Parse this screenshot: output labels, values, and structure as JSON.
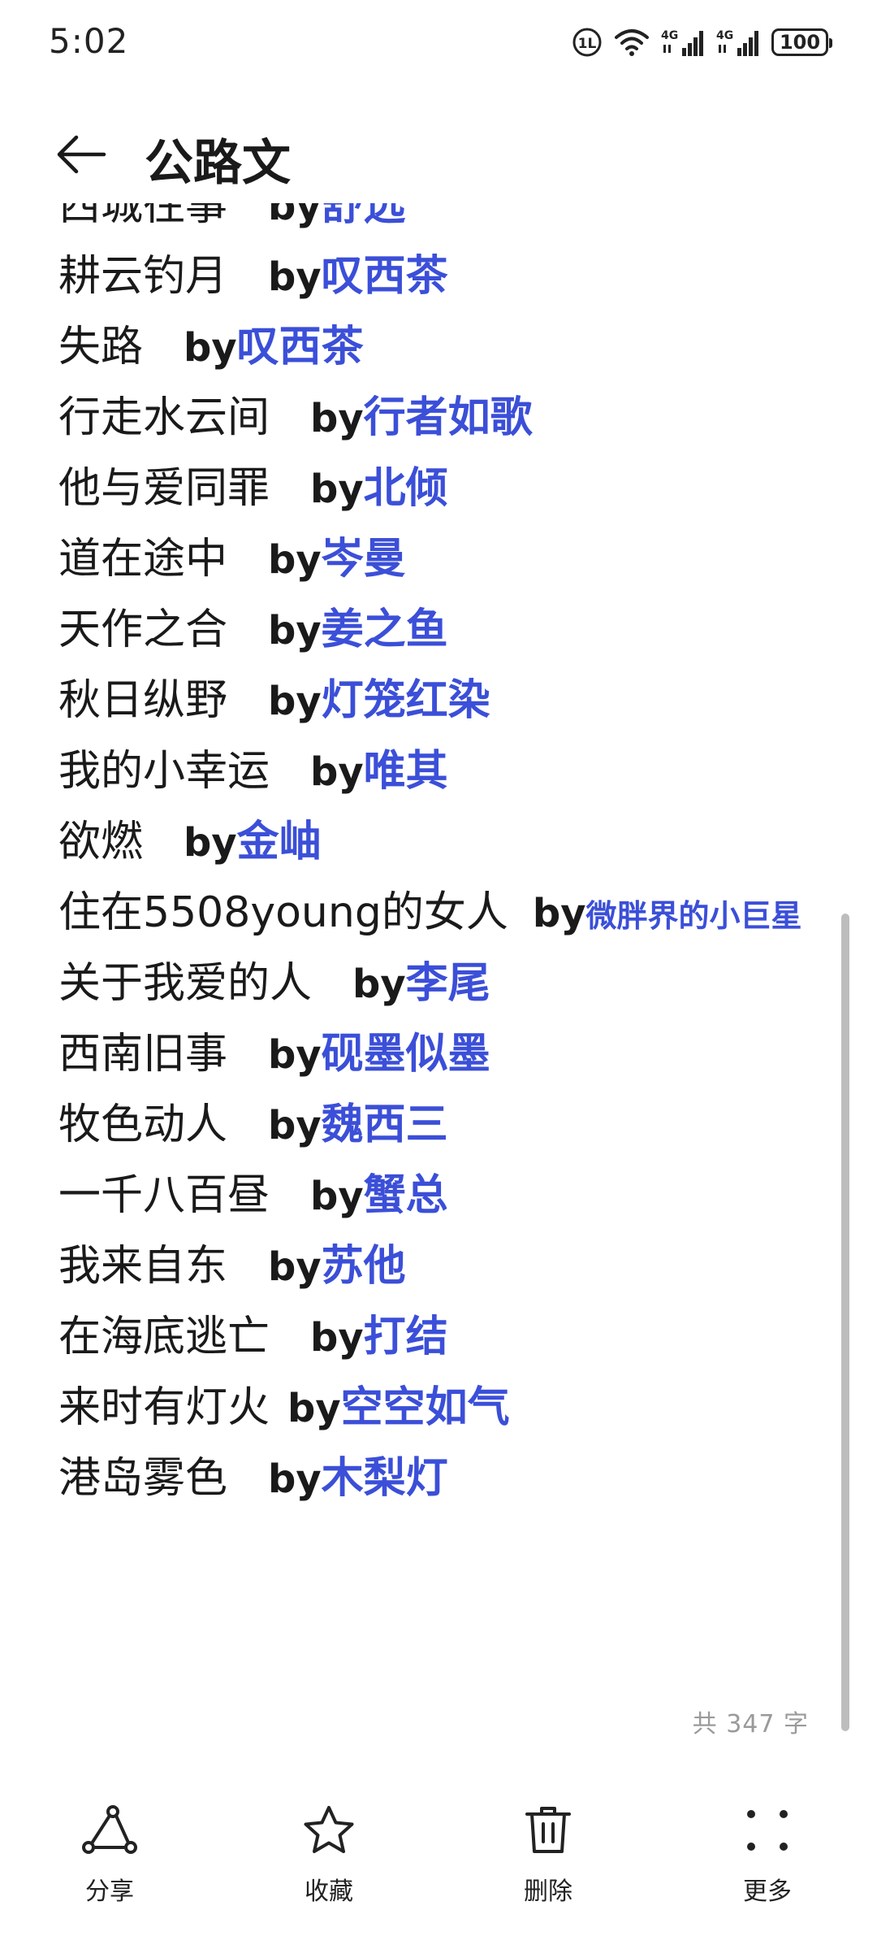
{
  "status_bar": {
    "time": "5:02",
    "battery": "100",
    "network_1": "4G",
    "network_2": "4G"
  },
  "header": {
    "title": "公路文"
  },
  "entries": [
    {
      "title": "西城往事",
      "by": "by",
      "author": "舒远"
    },
    {
      "title": "耕云钓月",
      "by": "by",
      "author": "叹西茶"
    },
    {
      "title": "失路",
      "by": "by",
      "author": "叹西茶"
    },
    {
      "title": "行走水云间",
      "by": "by",
      "author": "行者如歌"
    },
    {
      "title": "他与爱同罪",
      "by": "by",
      "author": "北倾"
    },
    {
      "title": "道在途中",
      "by": "by",
      "author": "岑曼"
    },
    {
      "title": "天作之合",
      "by": "by",
      "author": "姜之鱼"
    },
    {
      "title": "秋日纵野",
      "by": "by",
      "author": "灯笼红染"
    },
    {
      "title": "我的小幸运",
      "by": "by",
      "author": "唯其"
    },
    {
      "title": "欲燃",
      "by": "by",
      "author": "金岫"
    },
    {
      "title": "住在5508young的女人",
      "by": "by",
      "author": "微胖界的小巨星"
    },
    {
      "title": "关于我爱的人",
      "by": "by",
      "author": "李尾"
    },
    {
      "title": "西南旧事",
      "by": "by",
      "author": "砚墨似墨"
    },
    {
      "title": "牧色动人",
      "by": "by",
      "author": "魏西三"
    },
    {
      "title": "一千八百昼",
      "by": "by",
      "author": "蟹总"
    },
    {
      "title": "我来自东",
      "by": "by",
      "author": "苏他"
    },
    {
      "title": "在海底逃亡",
      "by": "by",
      "author": "打结"
    },
    {
      "title": "来时有灯火",
      "by": "by",
      "author": "空空如气"
    },
    {
      "title": "港岛雾色",
      "by": "by",
      "author": "木梨灯"
    }
  ],
  "footer": {
    "word_count": "共 347 字"
  },
  "bottom_bar": {
    "share": "分享",
    "favorite": "收藏",
    "delete": "删除",
    "more": "更多"
  },
  "colors": {
    "author": "#3b4fd8",
    "text": "#1a1a1a"
  }
}
